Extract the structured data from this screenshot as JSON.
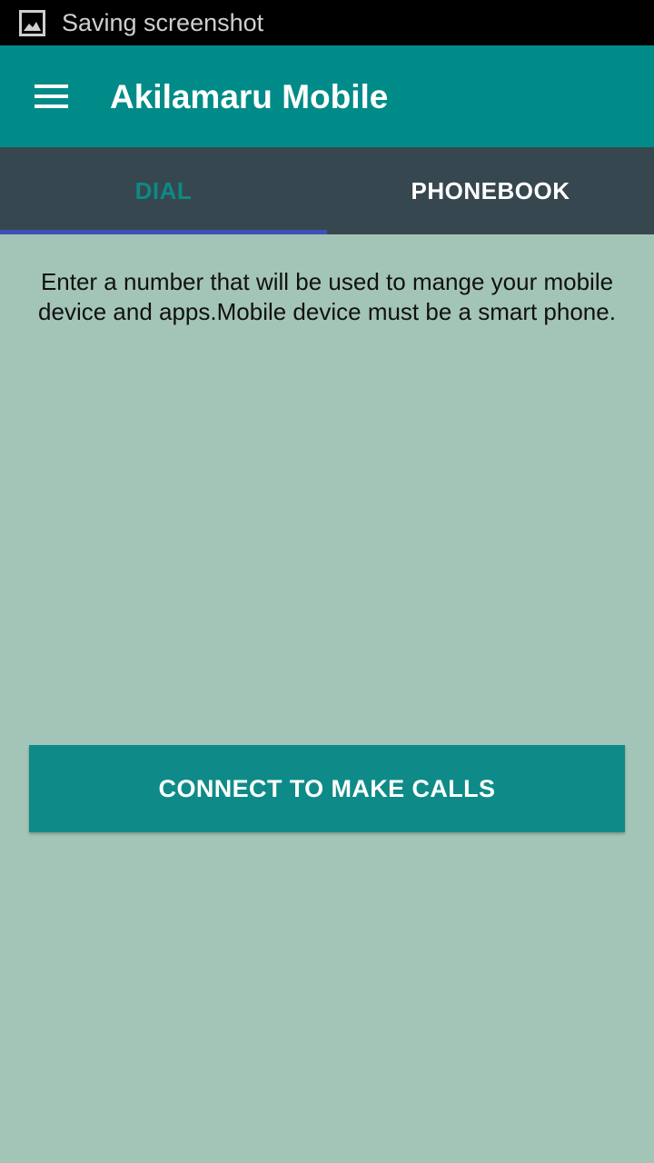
{
  "status_bar": {
    "icon": "image-icon",
    "text": "Saving screenshot"
  },
  "app_bar": {
    "menu_icon": "hamburger-menu-icon",
    "title": "Akilamaru Mobile",
    "background_color": "#008b88"
  },
  "tabs": [
    {
      "label": "DIAL",
      "selected": true
    },
    {
      "label": "PHONEBOOK",
      "selected": false
    }
  ],
  "main": {
    "instructions": "Enter a number that will be used to mange your mobile device and apps.Mobile device must be a smart phone.",
    "connect_button_label": "CONNECT TO MAKE CALLS",
    "background_color": "#a3c5b7",
    "button_color": "#0e8b88"
  }
}
